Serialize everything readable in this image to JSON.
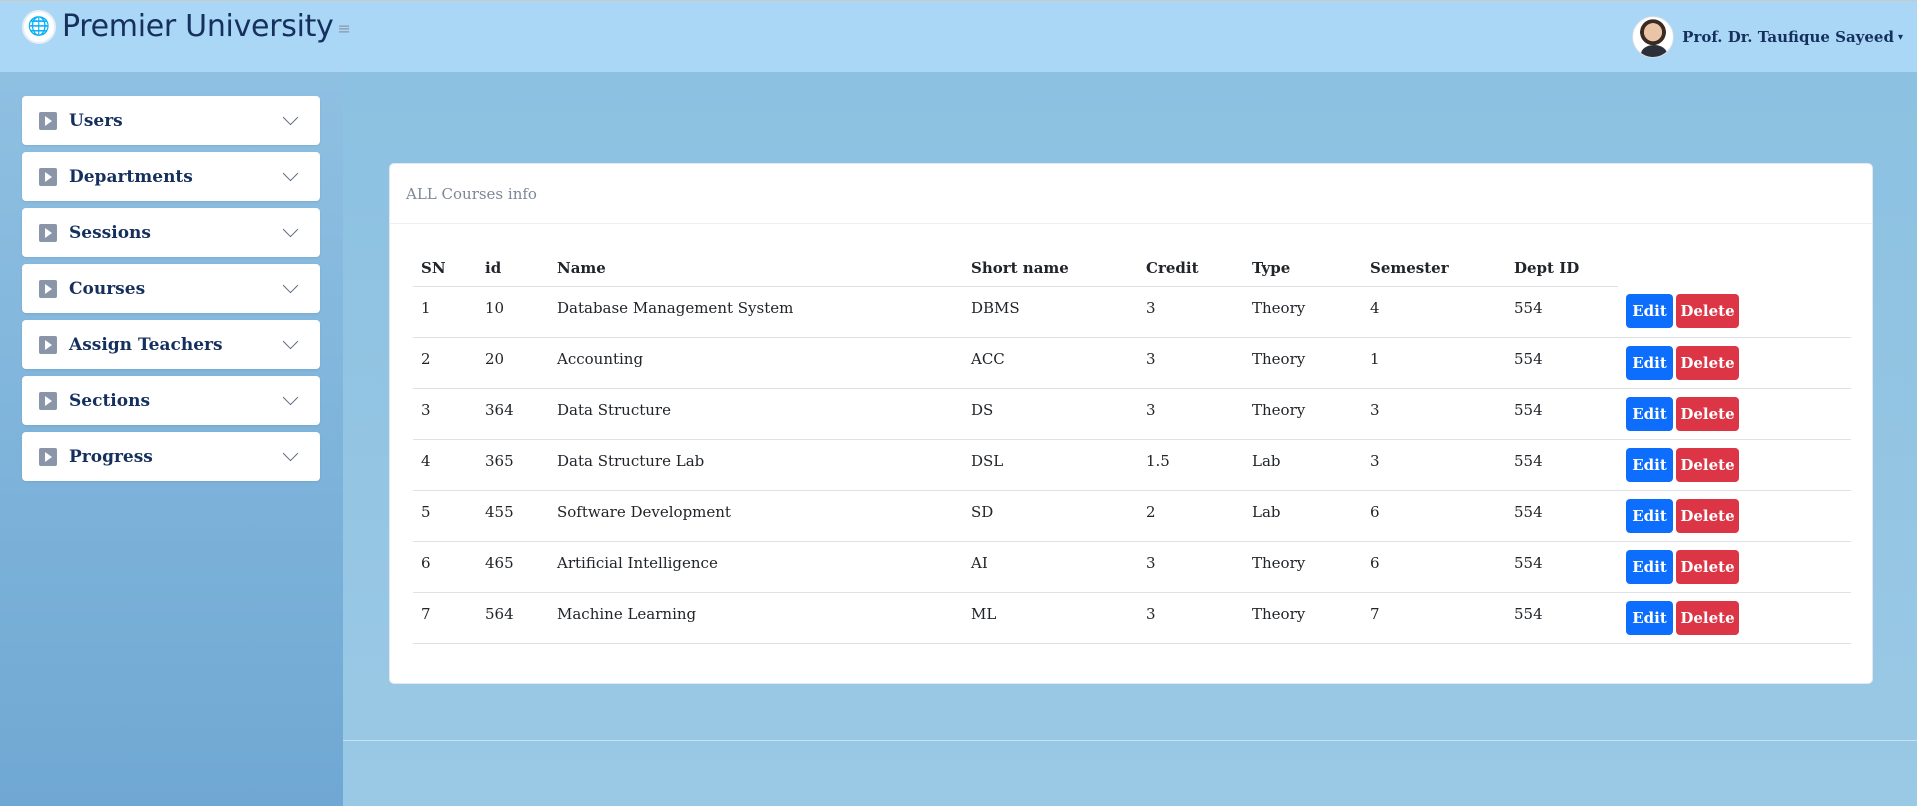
{
  "app": {
    "name": "Premier University",
    "menu_toggle": "≡",
    "user_name": "Prof. Dr. Taufique Sayeed",
    "caret": "▾",
    "logo_icon": "globe-logo-icon"
  },
  "sidebar": {
    "items": [
      {
        "label": "Users"
      },
      {
        "label": "Departments"
      },
      {
        "label": "Sessions"
      },
      {
        "label": "Courses"
      },
      {
        "label": "Assign Teachers"
      },
      {
        "label": "Sections"
      },
      {
        "label": "Progress"
      }
    ]
  },
  "courses": {
    "title": "ALL Courses info",
    "columns": [
      "SN",
      "id",
      "Name",
      "Short name",
      "Credit",
      "Type",
      "Semester",
      "Dept ID"
    ],
    "edit_label": "Edit",
    "delete_label": "Delete",
    "rows": [
      [
        "1",
        "10",
        "Database Management System",
        "DBMS",
        "3",
        "Theory",
        "4",
        "554"
      ],
      [
        "2",
        "20",
        "Accounting",
        "ACC",
        "3",
        "Theory",
        "1",
        "554"
      ],
      [
        "3",
        "364",
        "Data Structure",
        "DS",
        "3",
        "Theory",
        "3",
        "554"
      ],
      [
        "4",
        "365",
        "Data Structure Lab",
        "DSL",
        "1.5",
        "Lab",
        "3",
        "554"
      ],
      [
        "5",
        "455",
        "Software Development",
        "SD",
        "2",
        "Lab",
        "6",
        "554"
      ],
      [
        "6",
        "465",
        "Artificial Intelligence",
        "AI",
        "3",
        "Theory",
        "6",
        "554"
      ],
      [
        "7",
        "564",
        "Machine Learning",
        "ML",
        "3",
        "Theory",
        "7",
        "554"
      ]
    ]
  },
  "colors": {
    "header_bg": "#abd7f7",
    "brand_text": "#16305e",
    "edit_button": "#0d6efd",
    "delete_button": "#dc3545"
  }
}
